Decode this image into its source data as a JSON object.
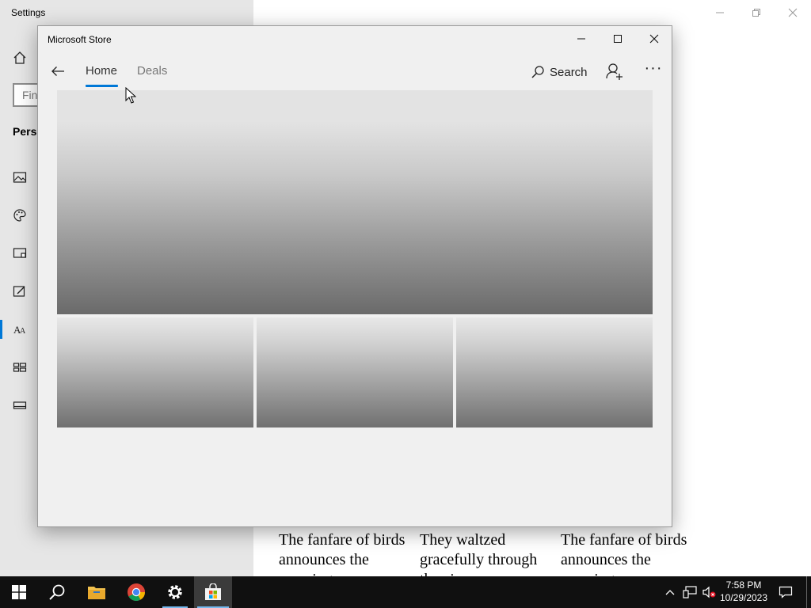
{
  "settings": {
    "title": "Settings",
    "search_placeholder": "Find a setting",
    "section": "Personalization",
    "nav_icons": [
      "picture-icon",
      "palette-icon",
      "lock-screen-icon",
      "themes-icon",
      "fonts-icon",
      "start-icon",
      "taskbar-icon"
    ],
    "active_item": "fonts-icon",
    "text_fragment": "s",
    "preview_texts": [
      "The fanfare of birds announces the morning.",
      "They waltzed gracefully through the air.",
      "The fanfare of birds announces the morning."
    ]
  },
  "store": {
    "title": "Microsoft Store",
    "tabs": [
      {
        "label": "Home",
        "active": true
      },
      {
        "label": "Deals",
        "active": false
      }
    ],
    "search_label": "Search",
    "more_label": "···",
    "accent": "#0078d7"
  },
  "taskbar": {
    "time": "7:58 PM",
    "date": "10/29/2023",
    "apps": [
      "start-icon",
      "search-icon",
      "file-explorer-icon",
      "chrome-icon",
      "settings-icon",
      "store-icon"
    ],
    "accent": "#76b9ed"
  }
}
